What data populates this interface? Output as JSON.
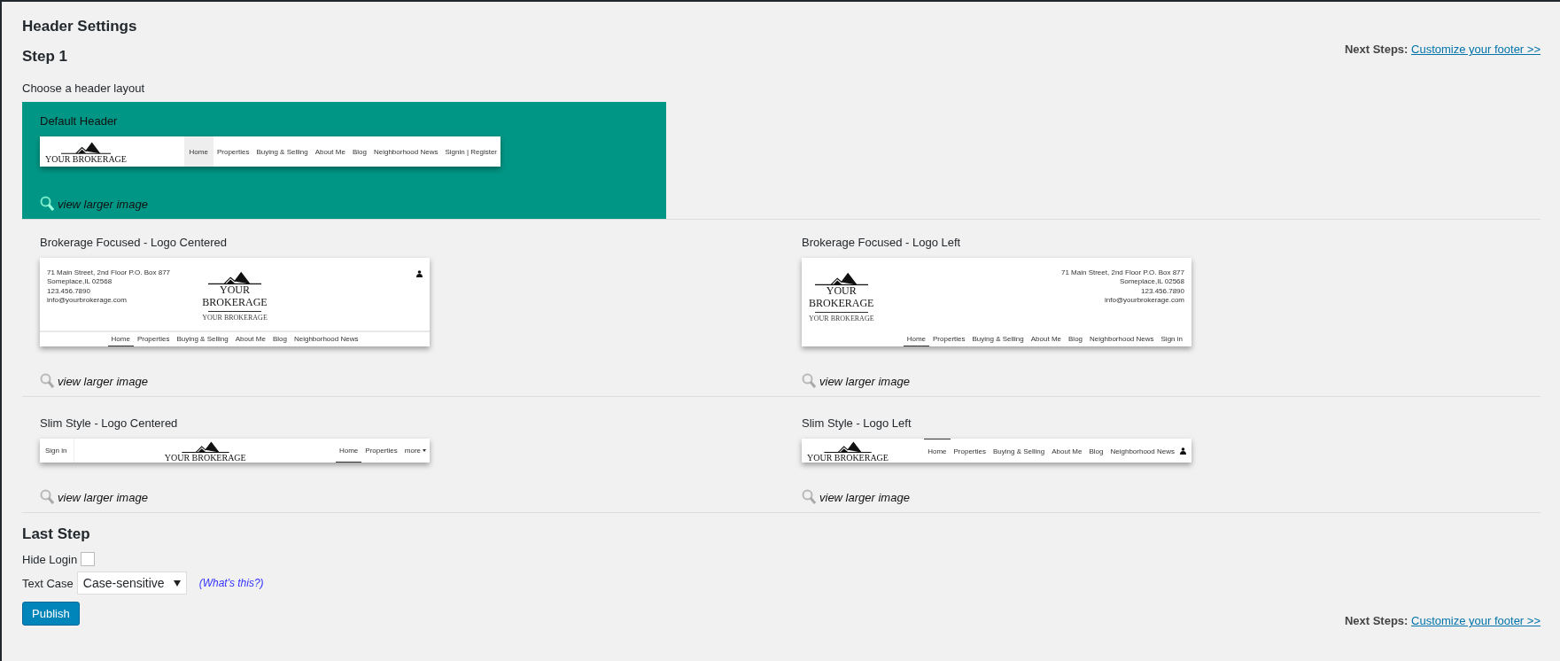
{
  "page_title": "Header Settings",
  "step1": {
    "title": "Step 1",
    "next_steps": {
      "label": "Next Steps:",
      "link": "Customize your footer >>"
    },
    "instruction": "Choose a header layout"
  },
  "layout_rows": [
    {
      "layouts": [
        {
          "kind": "default",
          "title": "Default Header",
          "selected": true,
          "link": "view larger image",
          "logo": [
            "YOUR BROKERAGE"
          ],
          "nav": [
            {
              "label": "Home",
              "selected": true
            },
            {
              "label": "Properties",
              "selected": false
            },
            {
              "label": "Buying & Selling",
              "selected": false
            },
            {
              "label": "About Me",
              "selected": false
            },
            {
              "label": "Blog",
              "selected": false
            },
            {
              "label": "Neighborhood News",
              "selected": false
            },
            {
              "label": "Signin | Register",
              "selected": false
            }
          ]
        }
      ]
    },
    {
      "layouts": [
        {
          "kind": "contact-centered",
          "title": "Brokerage Focused - Logo Centered",
          "selected": false,
          "link": "view larger image",
          "logo": [
            "YOUR",
            "BROKERAGE"
          ],
          "tagline": "YOUR BROKERAGE",
          "contact": [
            "71 Main Street, 2nd Floor P.O. Box 877",
            "Someplace,IL 02568",
            "123.456.7890",
            "info@yourbrokerage.com"
          ],
          "nav": [
            {
              "label": "Home",
              "selected": true
            },
            {
              "label": "Properties",
              "selected": false
            },
            {
              "label": "Buying & Selling",
              "selected": false
            },
            {
              "label": "About Me",
              "selected": false
            },
            {
              "label": "Blog",
              "selected": false
            },
            {
              "label": "Neighborhood News",
              "selected": false
            }
          ]
        },
        {
          "kind": "contact-left",
          "title": "Brokerage Focused - Logo Left",
          "selected": false,
          "link": "view larger image",
          "logo": [
            "YOUR",
            "BROKERAGE"
          ],
          "tagline": "YOUR BROKERAGE",
          "contact": [
            "71 Main Street, 2nd Floor P.O. Box 877",
            "Someplace,IL 02568",
            "123.456.7890",
            "info@yourbrokerage.com"
          ],
          "nav": [
            {
              "label": "Home",
              "selected": true
            },
            {
              "label": "Properties",
              "selected": false
            },
            {
              "label": "Buying & Selling",
              "selected": false
            },
            {
              "label": "About Me",
              "selected": false
            },
            {
              "label": "Blog",
              "selected": false
            },
            {
              "label": "Neighborhood News",
              "selected": false
            },
            {
              "label": "Sign in",
              "selected": false
            }
          ]
        }
      ]
    },
    {
      "layouts": [
        {
          "kind": "slim-centered",
          "title": "Slim Style - Logo Centered",
          "selected": false,
          "link": "view larger image",
          "logo": [
            "YOUR BROKERAGE"
          ],
          "sign_in": "Sign in",
          "nav": [
            {
              "label": "Home",
              "selected": true,
              "menu": false
            },
            {
              "label": "Properties",
              "selected": false,
              "menu": false
            },
            {
              "label": "more",
              "selected": false,
              "menu": true
            }
          ]
        },
        {
          "kind": "slim-left",
          "title": "Slim Style - Logo Left",
          "selected": false,
          "link": "view larger image",
          "logo": [
            "YOUR BROKERAGE"
          ],
          "nav": [
            {
              "label": "Home",
              "selected": true
            },
            {
              "label": "Properties",
              "selected": false
            },
            {
              "label": "Buying & Selling",
              "selected": false
            },
            {
              "label": "About Me",
              "selected": false
            },
            {
              "label": "Blog",
              "selected": false
            },
            {
              "label": "Neighborhood News",
              "selected": false
            }
          ]
        }
      ]
    }
  ],
  "last_step": {
    "title": "Last Step",
    "hide_login": {
      "label": "Hide Login",
      "checked": false
    },
    "text_case": {
      "label": "Text Case",
      "value": "Case-sensitive",
      "help": "(What's this?)"
    },
    "publish": "Publish",
    "next_steps": {
      "label": "Next Steps:",
      "link": "Customize your footer >>"
    }
  }
}
